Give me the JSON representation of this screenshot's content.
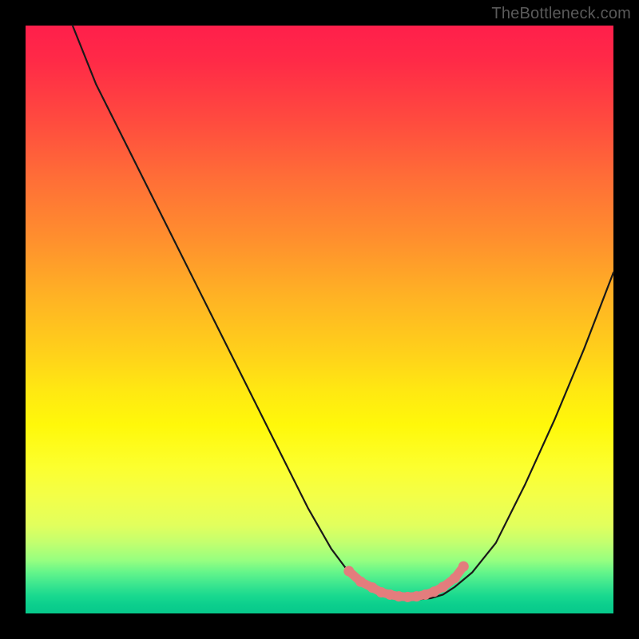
{
  "attribution": {
    "label": "TheBottleneck.com"
  },
  "colors": {
    "curve_stroke": "#191919",
    "marker_stroke": "#e37d7d",
    "marker_fill": "#e37d7d"
  },
  "chart_data": {
    "type": "line",
    "title": "",
    "xlabel": "",
    "ylabel": "",
    "xlim": [
      0,
      100
    ],
    "ylim": [
      0,
      100
    ],
    "series": [
      {
        "name": "bottleneck-curve",
        "x": [
          8,
          12,
          18,
          24,
          30,
          36,
          42,
          48,
          52,
          55,
          57,
          59,
          61,
          63,
          65,
          67,
          69,
          71,
          73,
          76,
          80,
          85,
          90,
          95,
          100
        ],
        "y": [
          100,
          90,
          78,
          66,
          54,
          42,
          30,
          18,
          11,
          7,
          5,
          3.8,
          3,
          2.6,
          2.4,
          2.4,
          2.6,
          3.2,
          4.5,
          7,
          12,
          22,
          33,
          45,
          58
        ]
      }
    ],
    "markers": [
      {
        "x": 55,
        "y": 7.2
      },
      {
        "x": 57,
        "y": 5.4
      },
      {
        "x": 59,
        "y": 4.4
      },
      {
        "x": 60.5,
        "y": 3.6
      },
      {
        "x": 62,
        "y": 3.2
      },
      {
        "x": 63.5,
        "y": 2.9
      },
      {
        "x": 65,
        "y": 2.8
      },
      {
        "x": 66.5,
        "y": 2.9
      },
      {
        "x": 68,
        "y": 3.2
      },
      {
        "x": 69.5,
        "y": 3.7
      },
      {
        "x": 71,
        "y": 4.5
      },
      {
        "x": 73,
        "y": 6.0
      },
      {
        "x": 74.5,
        "y": 8.0
      }
    ]
  }
}
